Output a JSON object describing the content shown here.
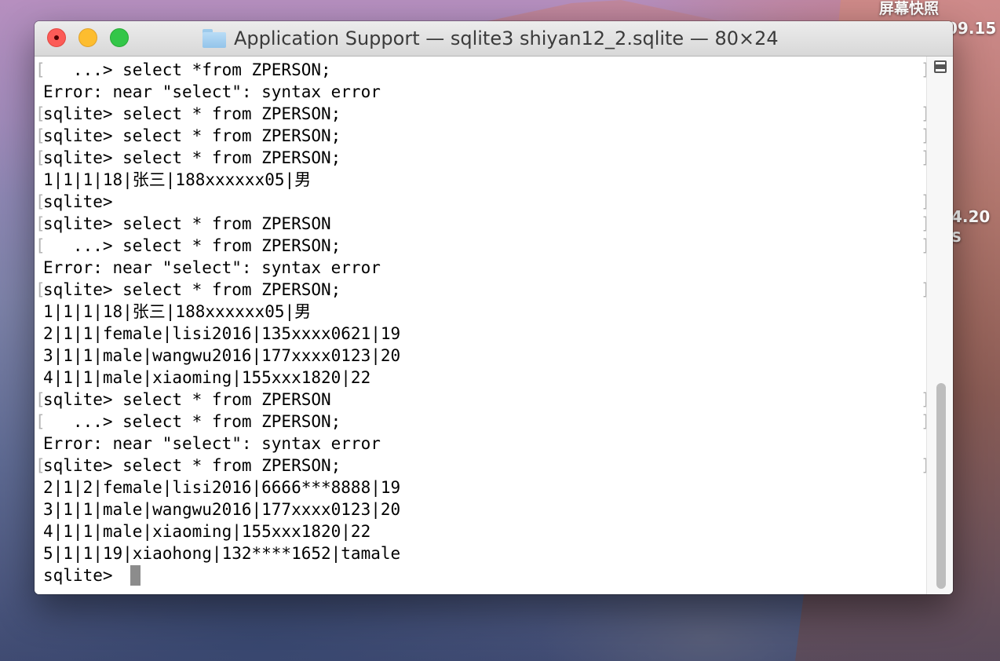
{
  "desktop": {
    "labels": [
      "屏幕快照",
      "09.15",
      "4.20",
      "S"
    ]
  },
  "window": {
    "title": "Application Support — sqlite3 shiyan12_2.sqlite — 80×24",
    "folder_icon": "folder-icon",
    "traffic_lights": {
      "close": "#fc5b57",
      "minimize": "#fdbd2f",
      "zoom": "#33c648"
    }
  },
  "terminal": {
    "lines": [
      {
        "text": "   ...> select *from ZPERSON;",
        "bracket_left": "[",
        "bracket_right": "]"
      },
      {
        "text": "Error: near \"select\": syntax error",
        "bracket_left": "",
        "bracket_right": ""
      },
      {
        "text": "sqlite> select * from ZPERSON;",
        "bracket_left": "[",
        "bracket_right": "]"
      },
      {
        "text": "sqlite> select * from ZPERSON;",
        "bracket_left": "[",
        "bracket_right": "]"
      },
      {
        "text": "sqlite> select * from ZPERSON;",
        "bracket_left": "[",
        "bracket_right": "]"
      },
      {
        "text": "1|1|1|18|张三|188xxxxxx05|男",
        "bracket_left": "",
        "bracket_right": ""
      },
      {
        "text": "sqlite>",
        "bracket_left": "[",
        "bracket_right": "]"
      },
      {
        "text": "sqlite> select * from ZPERSON",
        "bracket_left": "[",
        "bracket_right": "]"
      },
      {
        "text": "   ...> select * from ZPERSON;",
        "bracket_left": "[",
        "bracket_right": "]"
      },
      {
        "text": "Error: near \"select\": syntax error",
        "bracket_left": "",
        "bracket_right": ""
      },
      {
        "text": "sqlite> select * from ZPERSON;",
        "bracket_left": "[",
        "bracket_right": "]"
      },
      {
        "text": "1|1|1|18|张三|188xxxxxx05|男",
        "bracket_left": "",
        "bracket_right": ""
      },
      {
        "text": "2|1|1|female|lisi2016|135xxxx0621|19",
        "bracket_left": "",
        "bracket_right": ""
      },
      {
        "text": "3|1|1|male|wangwu2016|177xxxx0123|20",
        "bracket_left": "",
        "bracket_right": ""
      },
      {
        "text": "4|1|1|male|xiaoming|155xxx1820|22",
        "bracket_left": "",
        "bracket_right": ""
      },
      {
        "text": "sqlite> select * from ZPERSON",
        "bracket_left": "[",
        "bracket_right": "]"
      },
      {
        "text": "   ...> select * from ZPERSON;",
        "bracket_left": "[",
        "bracket_right": "]"
      },
      {
        "text": "Error: near \"select\": syntax error",
        "bracket_left": "",
        "bracket_right": ""
      },
      {
        "text": "sqlite> select * from ZPERSON;",
        "bracket_left": "[",
        "bracket_right": "]"
      },
      {
        "text": "2|1|2|female|lisi2016|6666***8888|19",
        "bracket_left": "",
        "bracket_right": ""
      },
      {
        "text": "3|1|1|male|wangwu2016|177xxxx0123|20",
        "bracket_left": "",
        "bracket_right": ""
      },
      {
        "text": "4|1|1|male|xiaoming|155xxx1820|22",
        "bracket_left": "",
        "bracket_right": ""
      },
      {
        "text": "5|1|1|19|xiaohong|132****1652|tamale",
        "bracket_left": "",
        "bracket_right": ""
      },
      {
        "text": "sqlite> ",
        "bracket_left": "",
        "bracket_right": ""
      }
    ],
    "cursor_line": 23,
    "cursor_color": "#8c8c8c"
  },
  "scrollbar": {
    "split_icon": "split-pane-icon",
    "position_fraction": 0.62
  }
}
